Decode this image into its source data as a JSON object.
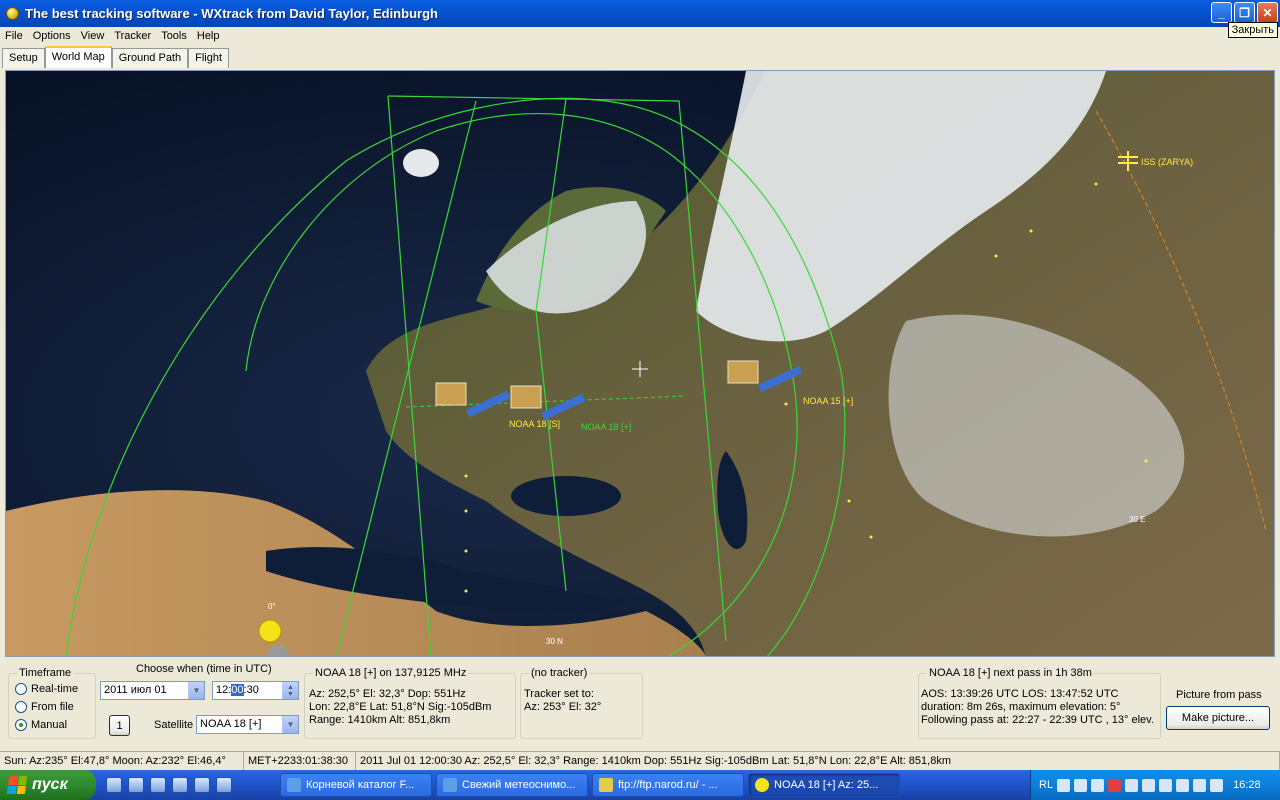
{
  "window": {
    "title": "The best tracking software - WXtrack from David Taylor, Edinburgh",
    "close_tooltip": "Закрыть"
  },
  "menu": [
    "File",
    "Options",
    "View",
    "Tracker",
    "Tools",
    "Help"
  ],
  "tabs": [
    "Setup",
    "World Map",
    "Ground Path",
    "Flight"
  ],
  "map": {
    "satellites": [
      {
        "label": "NOAA 18 [S]",
        "color": "#FFE84A"
      },
      {
        "label": "NOAA 18 [+]",
        "color": "#38D838"
      },
      {
        "label": "NOAA 15 [+]",
        "color": "#FFE84A"
      },
      {
        "label": "ISS (ZARYA)",
        "color": "#FFE84A"
      }
    ],
    "grid_labels": [
      "0°",
      "30 N",
      "30 E"
    ]
  },
  "timeframe": {
    "label": "Timeframe",
    "options": [
      "Real-time",
      "From file",
      "Manual"
    ],
    "selected": "Manual"
  },
  "choose_when": {
    "label": "Choose when (time in UTC)",
    "date": "2011 июл 01",
    "time_hh": "12:",
    "time_mm": "00",
    "time_ss": ":30",
    "step_button": "1",
    "satellite_label": "Satellite",
    "satellite_value": "NOAA 18 [+]"
  },
  "sat_info": {
    "label": "NOAA 18 [+] on 137,9125 MHz",
    "line1": "Az: 252,5°  El: 32,3°  Dop: 551Hz",
    "line2": "Lon: 22,8°E  Lat: 51,8°N  Sig:-105dBm",
    "line3": "Range: 1410km  Alt: 851,8km"
  },
  "tracker": {
    "label": "(no tracker)",
    "line1": "Tracker set to:",
    "line2": "Az: 253°  El: 32°"
  },
  "next_pass": {
    "label": "NOAA 18 [+] next pass in 1h 38m",
    "line1": "AOS: 13:39:26 UTC  LOS: 13:47:52 UTC",
    "line2": "duration: 8m 26s,  maximum elevation: 5°",
    "line3": "Following pass at: 22:27 - 22:39 UTC , 13° elev."
  },
  "picture": {
    "label": "Picture from pass",
    "button": "Make picture..."
  },
  "statusbar": [
    "Sun: Az:235° El:47,8°  Moon: Az:232° El:46,4°",
    "MET+2233:01:38:30",
    "2011 Jul 01  12:00:30  Az: 252,5°  El: 32,3°  Range: 1410km  Dop: 551Hz  Sig:-105dBm  Lat: 51,8°N  Lon: 22,8°E  Alt: 851,8km"
  ],
  "taskbar": {
    "start": "пуск",
    "tasks": [
      "Корневой каталог F...",
      "Свежий метеоснимо...",
      "ftp://ftp.narod.ru/ - ...",
      "NOAA 18 [+]  Az: 25..."
    ],
    "lang": "RL",
    "clock": "16:28"
  }
}
